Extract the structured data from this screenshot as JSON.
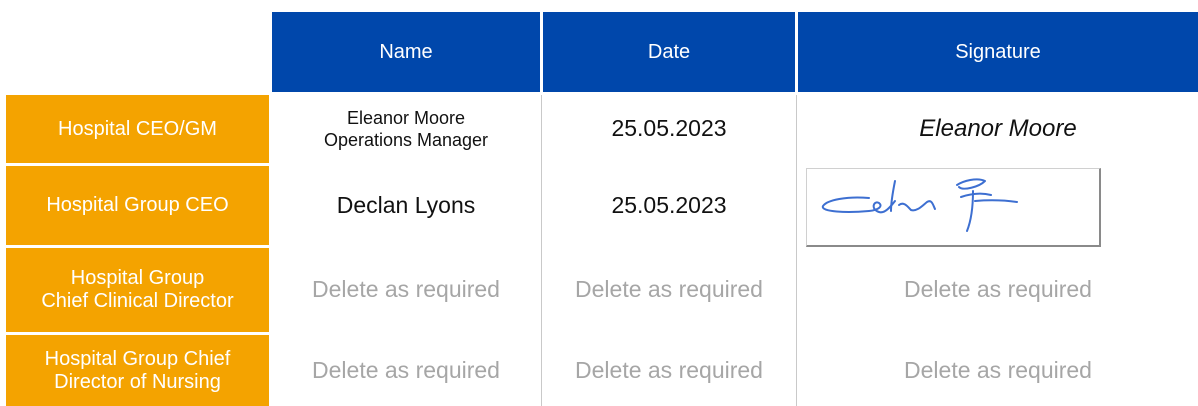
{
  "headers": {
    "name": "Name",
    "date": "Date",
    "signature": "Signature"
  },
  "rows": [
    {
      "role": "Hospital CEO/GM",
      "name_line1": "Eleanor Moore",
      "name_line2": "Operations Manager",
      "date": "25.05.2023",
      "signature": "Eleanor Moore"
    },
    {
      "role": "Hospital Group CEO",
      "name": "Declan Lyons",
      "date": "25.05.2023",
      "signature_icon": "handwritten-signature"
    },
    {
      "role_line1": "Hospital Group",
      "role_line2": "Chief Clinical Director",
      "name": "Delete as required",
      "date": "Delete as required",
      "signature": "Delete as required"
    },
    {
      "role_line1": "Hospital Group Chief",
      "role_line2": "Director of Nursing",
      "name": "Delete as required",
      "date": "Delete as required",
      "signature": "Delete as required"
    }
  ],
  "colors": {
    "header_bg": "#0047ab",
    "role_bg": "#f4a300",
    "placeholder_text": "#a6a6a6",
    "text": "#111111"
  }
}
